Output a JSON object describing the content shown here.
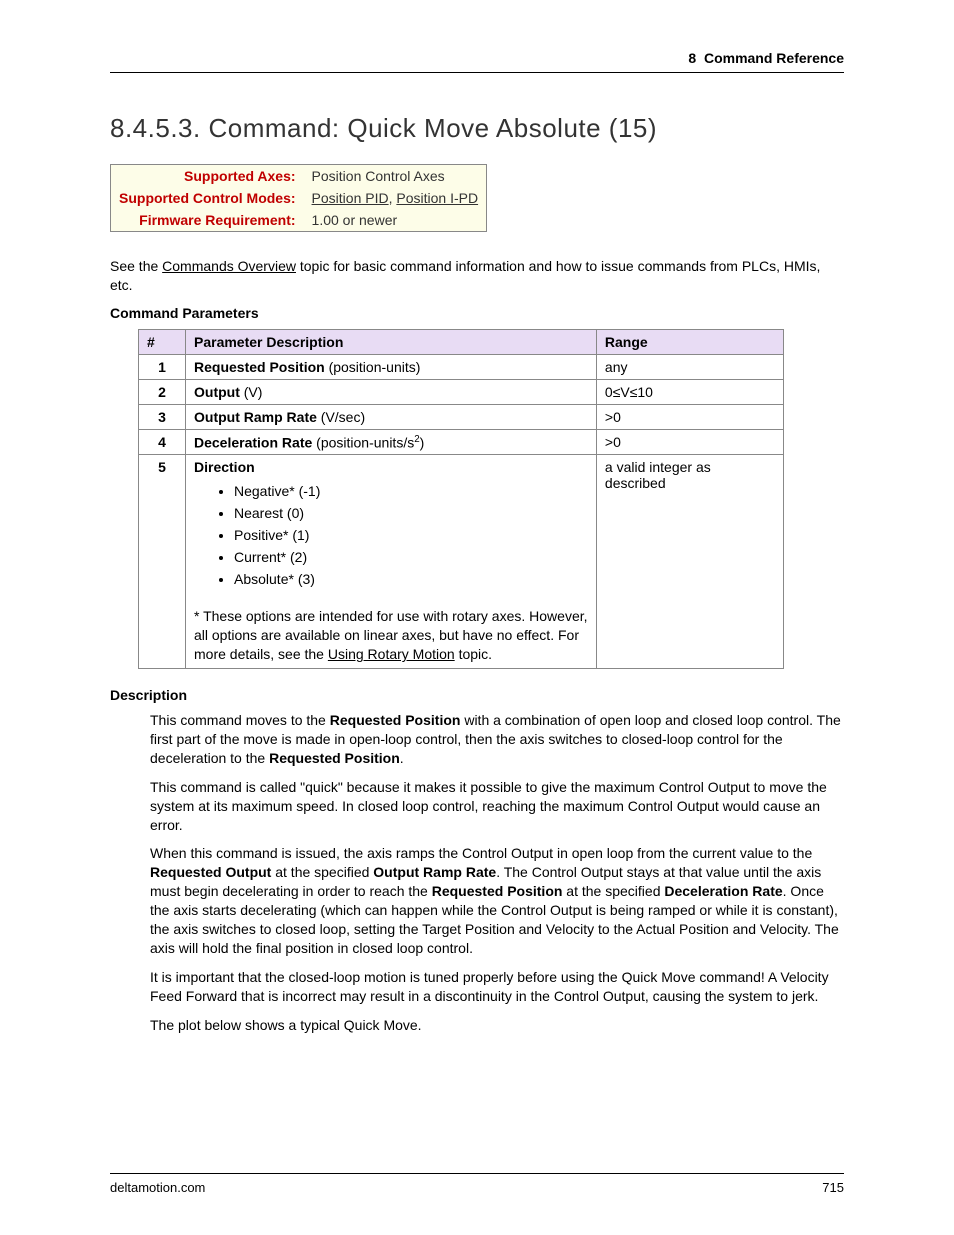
{
  "header": {
    "chapter": "8",
    "chapter_title": "Command Reference"
  },
  "section": {
    "number": "8.4.5.3.",
    "title": "Command: Quick Move Absolute (15)"
  },
  "info_box": {
    "rows": [
      {
        "label": "Supported Axes:",
        "value_plain": "Position Control Axes",
        "links": []
      },
      {
        "label": "Supported Control Modes:",
        "value_plain": "",
        "links": [
          "Position PID",
          "Position I-PD"
        ]
      },
      {
        "label": "Firmware Requirement:",
        "value_plain": "1.00 or newer",
        "links": []
      }
    ]
  },
  "intro": {
    "prefix": "See the ",
    "link": "Commands Overview",
    "suffix": " topic for basic command information and how to issue commands from PLCs, HMIs, etc."
  },
  "params_heading": "Command Parameters",
  "params_table": {
    "headers": {
      "num": "#",
      "desc": "Parameter Description",
      "range": "Range"
    },
    "rows": [
      {
        "num": "1",
        "desc_bold": "Requested Position",
        "desc_rest": " (position-units)",
        "range": "any"
      },
      {
        "num": "2",
        "desc_bold": "Output",
        "desc_rest": " (V)",
        "range": "0≤V≤10"
      },
      {
        "num": "3",
        "desc_bold": "Output Ramp Rate",
        "desc_rest": " (V/sec)",
        "range": ">0"
      },
      {
        "num": "4",
        "desc_bold": "Deceleration Rate",
        "desc_rest": " (position-units/s",
        "sup": "2",
        "desc_after_sup": ")",
        "range": ">0"
      }
    ],
    "direction_row": {
      "num": "5",
      "label": "Direction",
      "items": [
        "Negative* (-1)",
        "Nearest (0)",
        "Positive* (1)",
        "Current* (2)",
        "Absolute* (3)"
      ],
      "footnote_prefix": "* These options are intended for use with rotary axes. However, all options are available on linear axes, but have no effect. For more details, see the ",
      "footnote_link": "Using Rotary Motion",
      "footnote_suffix": " topic.",
      "range": "a valid integer as described"
    }
  },
  "description_heading": "Description",
  "description": {
    "p1_a": "This command moves to the ",
    "p1_b": "Requested Position",
    "p1_c": " with a combination of open loop and closed loop control. The first part of the move is made in open-loop control, then the axis switches to closed-loop control for the deceleration to the ",
    "p1_d": "Requested Position",
    "p1_e": ".",
    "p2": "This command is called \"quick\" because it makes it possible to give the maximum Control Output to move the system at its maximum speed. In closed loop control, reaching the maximum Control Output would cause an error.",
    "p3_a": "When this command is issued, the axis ramps the Control Output in open loop from the current value to the ",
    "p3_b": "Requested Output",
    "p3_c": " at the specified ",
    "p3_d": "Output Ramp Rate",
    "p3_e": ".  The Control Output stays at that value until the axis must begin decelerating in order to reach the ",
    "p3_f": "Requested Position",
    "p3_g": " at the specified ",
    "p3_h": "Deceleration Rate",
    "p3_i": ". Once the axis starts decelerating (which can happen while the Control Output is being ramped or while it is constant), the axis switches to closed loop, setting the Target Position and Velocity to the Actual Position and Velocity. The axis will hold the final position in closed loop control.",
    "p4": "It is important that the closed-loop motion is tuned properly before using the Quick Move command! A Velocity Feed Forward that is incorrect may result in a discontinuity in the Control Output, causing the system to jerk.",
    "p5": "The plot below shows a typical Quick Move."
  },
  "footer": {
    "site": "deltamotion.com",
    "page": "715"
  }
}
